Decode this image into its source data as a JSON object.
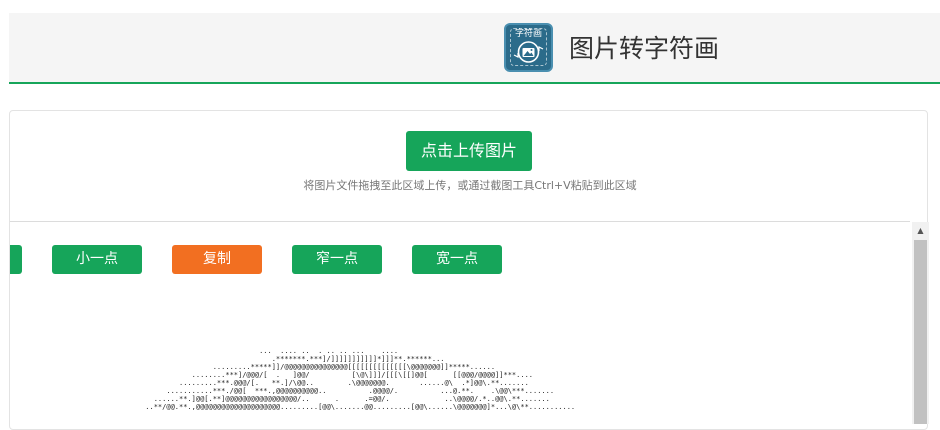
{
  "header": {
    "logo_text": "字符画",
    "title": "图片转字符画"
  },
  "upload": {
    "button_label": "点击上传图片",
    "hint": "将图片文件拖拽至此区域上传，或通过截图工具Ctrl+V粘贴到此区域"
  },
  "toolbar": {
    "buttons": [
      {
        "label": "",
        "color": "#16a55a"
      },
      {
        "label": "小一点",
        "color": "#16a55a"
      },
      {
        "label": "复制",
        "color": "#f26f21"
      },
      {
        "label": "窄一点",
        "color": "#16a55a"
      },
      {
        "label": "宽一点",
        "color": "#16a55a"
      }
    ]
  },
  "ascii_art": {
    "lines": [
      "                                 ...  .... ..  . .. .. ...    ....",
      "                                    .*******.***]/]]]]]]]]]]]*]]]**.******...",
      "                      .........*****]]/@@@@@@@@@@@@@@@[[[[[[[[[[[[[[\\@@@@@@@]]*****......",
      "                 ........***]/@@@/[  .   ]@@/          [\\@\\]]]/[[[\\[[]@@[      [[@@@/@@@@]]***....",
      "              .........***.@@@/[.   **.]/\\@@..        .\\@@@@@@@.       ......@\\  .*]@@\\.**.......",
      "           ...........***./@@[  ***.,@@@@@@@@@@..          .@@@@/.          ...@.**.    .\\@@\\***.......",
      "        ......**.]@@[.**]@@@@@@@@@@@@@@@@@/..      .      .=@@/.             ..\\@@@@/.*..@@\\.**.......",
      "      ..**/@@.**.,@@@@@@@@@@@@@@@@@@@@.........[@@\\.......@@.........[@@\\......\\@@@@@@@]*...\\@\\**..........."
    ]
  }
}
